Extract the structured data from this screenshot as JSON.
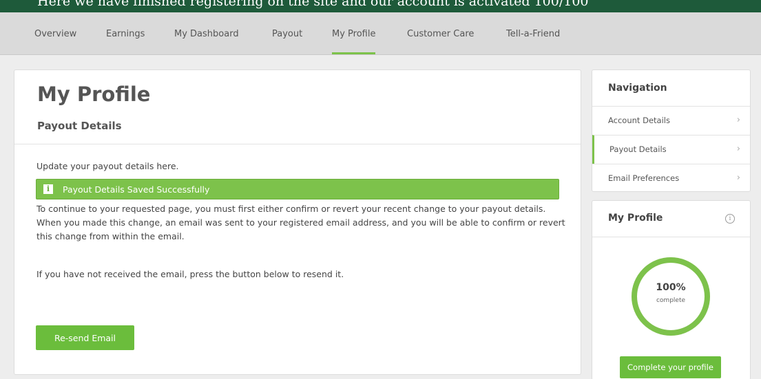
{
  "banner": {
    "text": "Here we have finished registering on the site and our account is activated 100/100"
  },
  "nav": {
    "items": [
      {
        "label": "Overview"
      },
      {
        "label": "Earnings"
      },
      {
        "label": "My Dashboard"
      },
      {
        "label": "Payout"
      },
      {
        "label": "My Profile"
      },
      {
        "label": "Customer Care"
      },
      {
        "label": "Tell-a-Friend"
      }
    ],
    "active": "My Profile"
  },
  "main": {
    "title": "My Profile",
    "section_title": "Payout Details",
    "intro": "Update your payout details here.",
    "alert": {
      "icon": "info-icon",
      "text": "Payout Details Saved Successfully"
    },
    "paragraph": "To continue to your requested page, you must first either confirm or revert your recent change to your payout details. When you made this change, an email was sent to your registered email address, and you will be able to confirm or revert this change from within the email.",
    "resend_text": "If you have not received the email, press the button below to resend it.",
    "resend_button": "Re-send Email"
  },
  "sidebar": {
    "title": "Navigation",
    "items": [
      {
        "label": "Account Details",
        "active": false
      },
      {
        "label": "Payout Details",
        "active": true
      },
      {
        "label": "Email Preferences",
        "active": false
      }
    ]
  },
  "profile": {
    "title": "My Profile",
    "progress_value": "100%",
    "progress_label": "complete",
    "progress_fraction": 1.0,
    "button": "Complete your profile"
  },
  "colors": {
    "accent": "#7dc24b",
    "button": "#6bbd3c",
    "banner": "#1e5a3a"
  }
}
